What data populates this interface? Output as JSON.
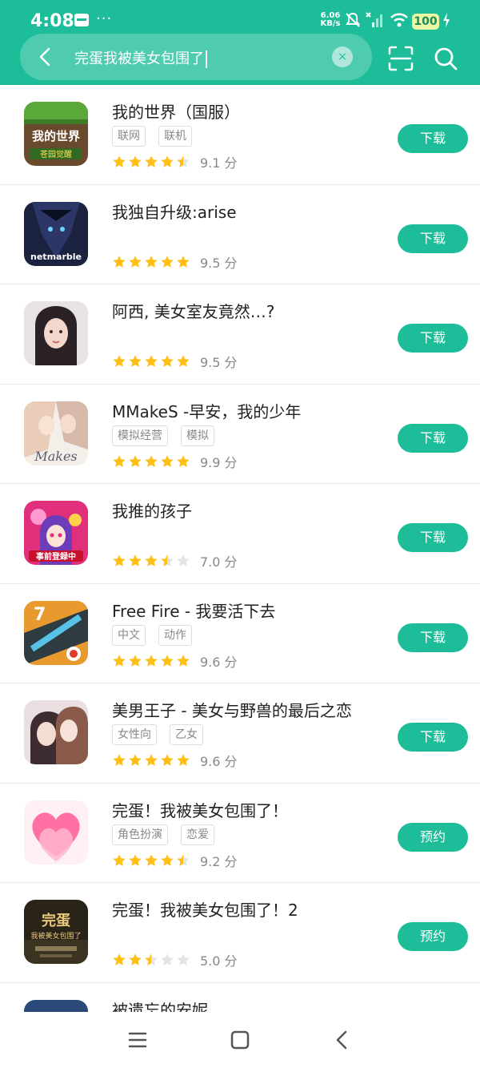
{
  "status_bar": {
    "time": "4:08",
    "net_speed_value": "6.06",
    "net_speed_unit": "KB/s",
    "battery": "100",
    "icons": [
      "notification-icon",
      "more-dots-icon",
      "mute-icon",
      "signal-icon",
      "wifi-icon",
      "battery-icon",
      "charging-icon"
    ]
  },
  "search": {
    "query": "完蛋我被美女包围了",
    "clear_label": "×"
  },
  "colors": {
    "accent": "#1ebd9a",
    "star_full": "#ffbf17",
    "star_empty": "#e3e3e3"
  },
  "apps": [
    {
      "name": "我的世界（国服）",
      "tags": [
        "联网",
        "联机"
      ],
      "rating": 4.5,
      "score": "9.1 分",
      "button": "下载",
      "icon": "minecraft-icon"
    },
    {
      "name": "我独自升级:arise",
      "tags": [],
      "rating": 5,
      "score": "9.5 分",
      "button": "下载",
      "icon": "solo-leveling-icon"
    },
    {
      "name": "阿西, 美女室友竟然…?",
      "tags": [],
      "rating": 5,
      "score": "9.5 分",
      "button": "下载",
      "icon": "roommate-icon"
    },
    {
      "name": "MMakeS -早安，我的少年",
      "tags": [
        "模拟经营",
        "模拟"
      ],
      "rating": 5,
      "score": "9.9 分",
      "button": "下载",
      "icon": "mmakes-icon"
    },
    {
      "name": "我推的孩子",
      "tags": [],
      "rating": 3.5,
      "score": "7.0 分",
      "button": "下载",
      "icon": "oshi-no-ko-icon"
    },
    {
      "name": "Free Fire - 我要活下去",
      "tags": [
        "中文",
        "动作"
      ],
      "rating": 5,
      "score": "9.6 分",
      "button": "下载",
      "icon": "free-fire-icon"
    },
    {
      "name": "美男王子 - 美女与野兽的最后之恋",
      "tags": [
        "女性向",
        "乙女"
      ],
      "rating": 5,
      "score": "9.6 分",
      "button": "下载",
      "icon": "prince-icon"
    },
    {
      "name": "完蛋！我被美女包围了！",
      "tags": [
        "角色扮演",
        "恋爱"
      ],
      "rating": 4.5,
      "score": "9.2 分",
      "button": "预约",
      "icon": "heart-icon"
    },
    {
      "name": "完蛋！我被美女包围了！2",
      "tags": [],
      "rating": 2.5,
      "score": "5.0 分",
      "button": "预约",
      "icon": "sequel-icon"
    },
    {
      "name": "被遗忘的安妮",
      "tags": [],
      "rating": 0,
      "score": "",
      "button": "",
      "icon": "annie-icon"
    }
  ]
}
